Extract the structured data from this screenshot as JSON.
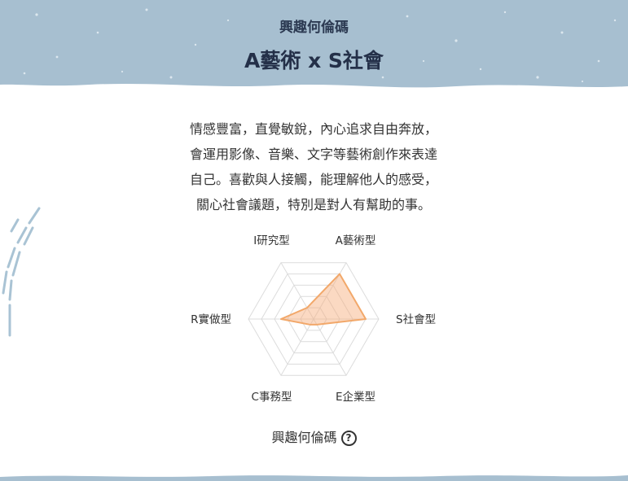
{
  "header": {
    "subtitle": "興趣何倫碼",
    "title": "A藝術 x S社會"
  },
  "description": {
    "lines": [
      "情感豐富，直覺敏銳，內心追求自由奔放，",
      "會運用影像、音樂、文字等藝術創作來表達",
      "自己。喜歡與人接觸，能理解他人的感受，",
      "關心社會議題，特別是對人有幫助的事。"
    ]
  },
  "chart_data": {
    "type": "radar",
    "axes": [
      "I研究型",
      "A藝術型",
      "S社會型",
      "E企業型",
      "C事務型",
      "R實做型"
    ],
    "max": 10,
    "grid_levels": 5,
    "series": [
      {
        "values": [
          2,
          8,
          8,
          1,
          1,
          5
        ]
      }
    ],
    "colors": {
      "fill": "rgba(247,170,120,0.45)",
      "stroke": "#f2a86a",
      "grid": "#dcdcdc"
    }
  },
  "footer": {
    "label": "興趣何倫碼",
    "help_icon": "question-circle-icon",
    "help_glyph": "?"
  },
  "colors": {
    "header_bg": "#a7bfd0",
    "snow": "#e6eef4",
    "deco": "#a9c3d4",
    "title": "#243049"
  }
}
